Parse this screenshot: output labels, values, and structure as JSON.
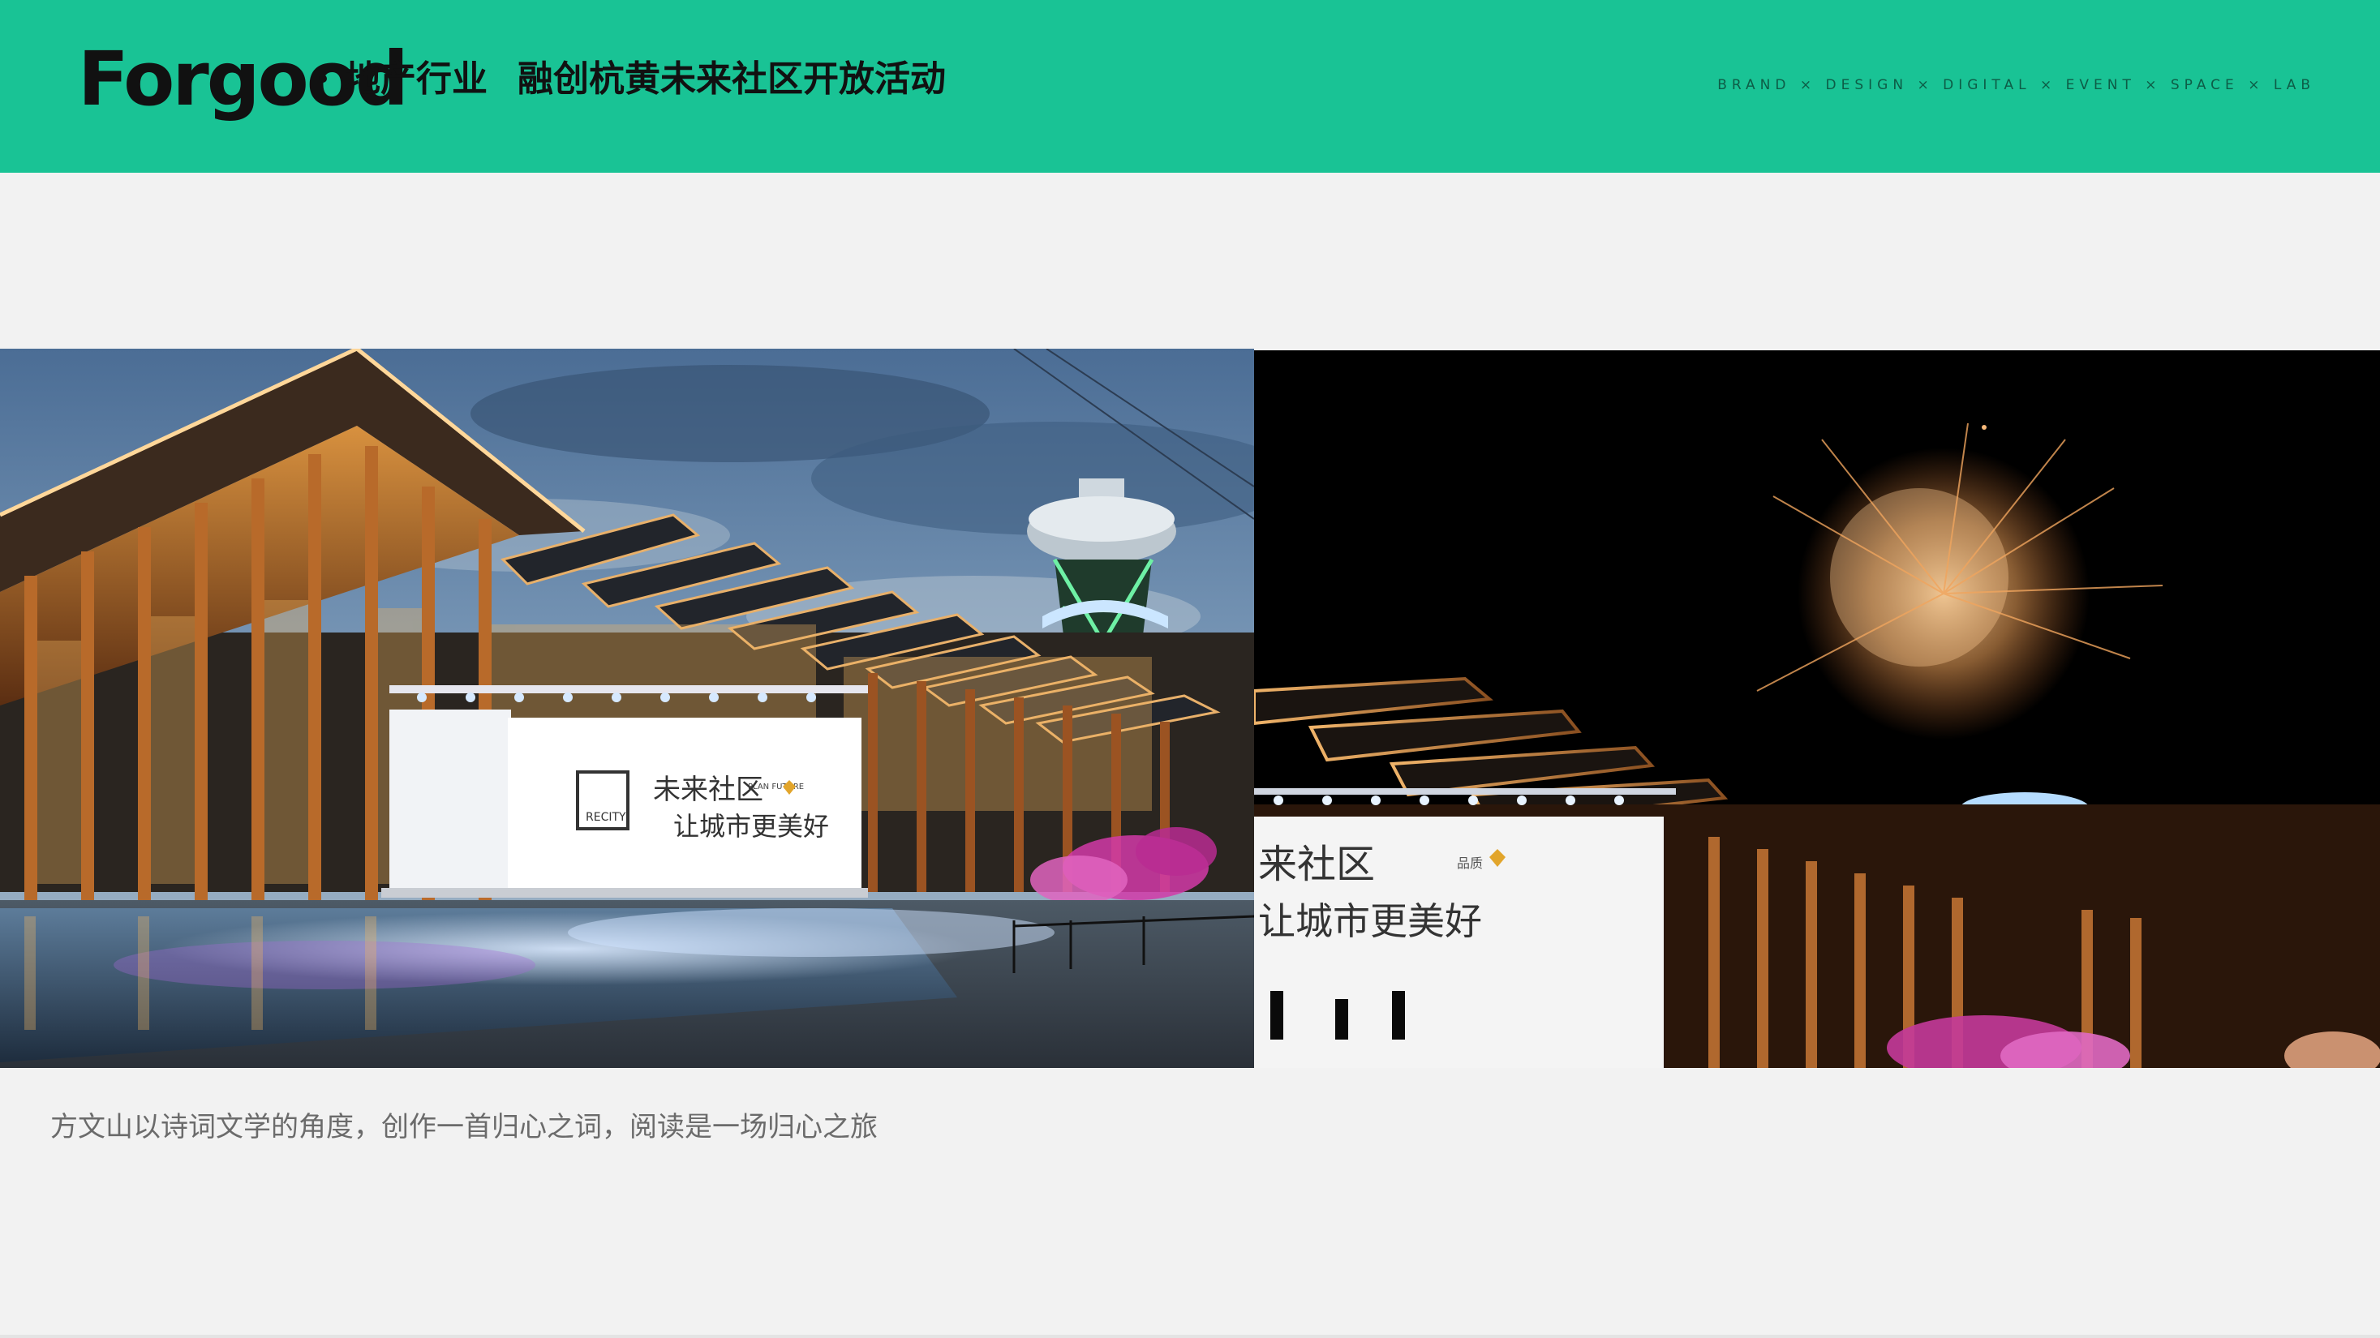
{
  "header": {
    "logo": "Forgood",
    "industry": "地产行业",
    "event_title": "融创杭黄未来社区开放活动",
    "tagline": "BRAND × DESIGN × DIGITAL × EVENT × SPACE × LAB",
    "background_color": "#19c395"
  },
  "photos": {
    "left": {
      "sign_line1": "未来社区",
      "sign_line2": "让城市更美好",
      "sign_logo": "RECITY",
      "sign_badge": "PLAN FUTURE"
    },
    "right": {
      "sign_line1": "来社区",
      "sign_line2": "让城市更美好",
      "sign_badge": "品质"
    }
  },
  "caption": "方文山以诗词文学的角度，创作一首归心之词，阅读是一场归心之旅"
}
